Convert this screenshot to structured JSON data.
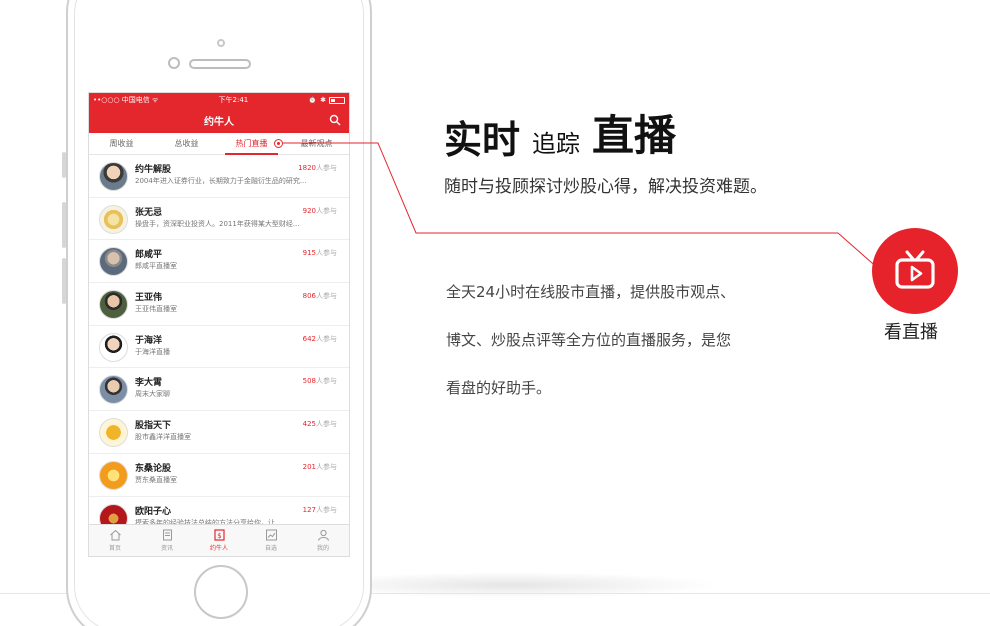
{
  "phone": {
    "status": {
      "carrier": "••○○○ 中国电信 ᯤ",
      "time": "下午2:41"
    },
    "nav_title": "约牛人",
    "tabs": [
      {
        "label": "周收益"
      },
      {
        "label": "总收益"
      },
      {
        "label": "热门直播"
      },
      {
        "label": "最新观点"
      }
    ],
    "count_unit": "人参与",
    "rows": [
      {
        "name": "约牛解股",
        "desc": "2004年进入证券行业，长期致力于金融衍生品的研究...",
        "count": "1820"
      },
      {
        "name": "张无忌",
        "desc": "操盘手，资深职业投资人。2011年获得某大型财经...",
        "count": "920"
      },
      {
        "name": "郎咸平",
        "desc": "郎咸平直播室",
        "count": "915"
      },
      {
        "name": "王亚伟",
        "desc": "王亚伟直播室",
        "count": "806"
      },
      {
        "name": "于海洋",
        "desc": "于海洋直播",
        "count": "642"
      },
      {
        "name": "李大霄",
        "desc": "周末大家聊",
        "count": "508"
      },
      {
        "name": "股指天下",
        "desc": "股市鑫洋洋直播室",
        "count": "425"
      },
      {
        "name": "东桑论股",
        "desc": "贾东桑直播室",
        "count": "201"
      },
      {
        "name": "欧阳子心",
        "desc": "摸索多年的经验技法总结的方法分享给你，让...",
        "count": "127"
      }
    ],
    "tabbar": [
      {
        "label": "首页",
        "icon": "home-icon"
      },
      {
        "label": "资讯",
        "icon": "news-icon"
      },
      {
        "label": "约牛人",
        "icon": "expert-icon"
      },
      {
        "label": "自选",
        "icon": "chart-icon"
      },
      {
        "label": "我的",
        "icon": "user-icon"
      }
    ]
  },
  "headline": {
    "part1": "实时",
    "part2": "追踪",
    "part3": "直播"
  },
  "subtitle": "随时与投顾探讨炒股心得，解决投资难题。",
  "paragraph": {
    "line1": "全天24小时在线股市直播，提供股市观点、",
    "line2": "博文、炒股点评等全方位的直播服务，是您",
    "line3": "看盘的好助手。"
  },
  "badge": {
    "label": "看直播",
    "icon": "tv-play-icon"
  },
  "colors": {
    "accent": "#e4262d"
  }
}
